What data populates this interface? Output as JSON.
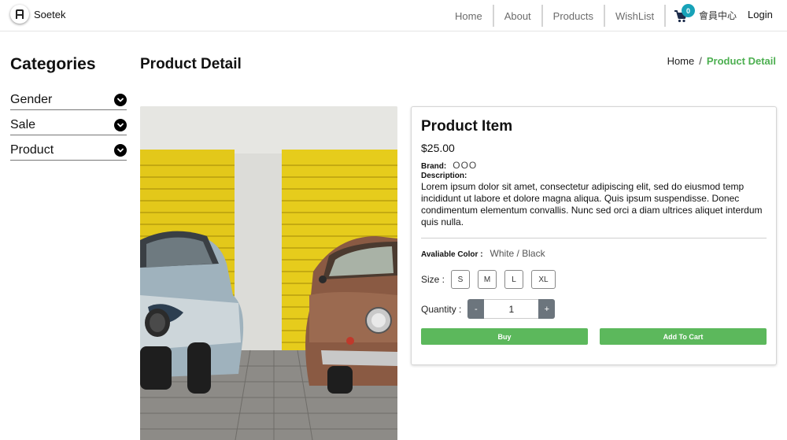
{
  "navbar": {
    "brand_name": "Soetek",
    "links": [
      "Home",
      "About",
      "Products",
      "WishList"
    ],
    "cart_count": "0",
    "member_label": "會員中心",
    "login_label": "Login"
  },
  "sidebar": {
    "title": "Categories",
    "items": [
      {
        "label": "Gender",
        "icon": "chevron-down-circle-icon"
      },
      {
        "label": "Sale",
        "icon": "chevron-down-circle-icon"
      },
      {
        "label": "Product",
        "icon": "chevron-down-circle-icon"
      }
    ]
  },
  "page": {
    "title": "Product Detail",
    "breadcrumb": {
      "home": "Home",
      "separator": "/",
      "current": "Product Detail"
    }
  },
  "product": {
    "name": "Product Item",
    "price": "$25.00",
    "brand_label": "Brand:",
    "brand_value": "OOO",
    "description_label": "Description:",
    "description": "Lorem ipsum dolor sit amet, consectetur adipiscing elit, sed do eiusmod temp incididunt ut labore et dolore magna aliqua. Quis ipsum suspendisse. Donec condimentum elementum convallis. Nunc sed orci a diam ultrices aliquet interdum quis nulla.",
    "color_label": "Avaliable Color :",
    "color_value": "White / Black",
    "size_label": "Size :",
    "sizes": [
      "S",
      "M",
      "L",
      "XL"
    ],
    "quantity_label": "Quantity :",
    "quantity_minus": "-",
    "quantity_value": "1",
    "quantity_plus": "+",
    "buy_label": "Buy",
    "add_to_cart_label": "Add To Cart"
  },
  "colors": {
    "accent_green": "#4caf50",
    "button_green": "#5cb85c",
    "badge_teal": "#17a2b8",
    "qty_gray": "#6c757d"
  }
}
